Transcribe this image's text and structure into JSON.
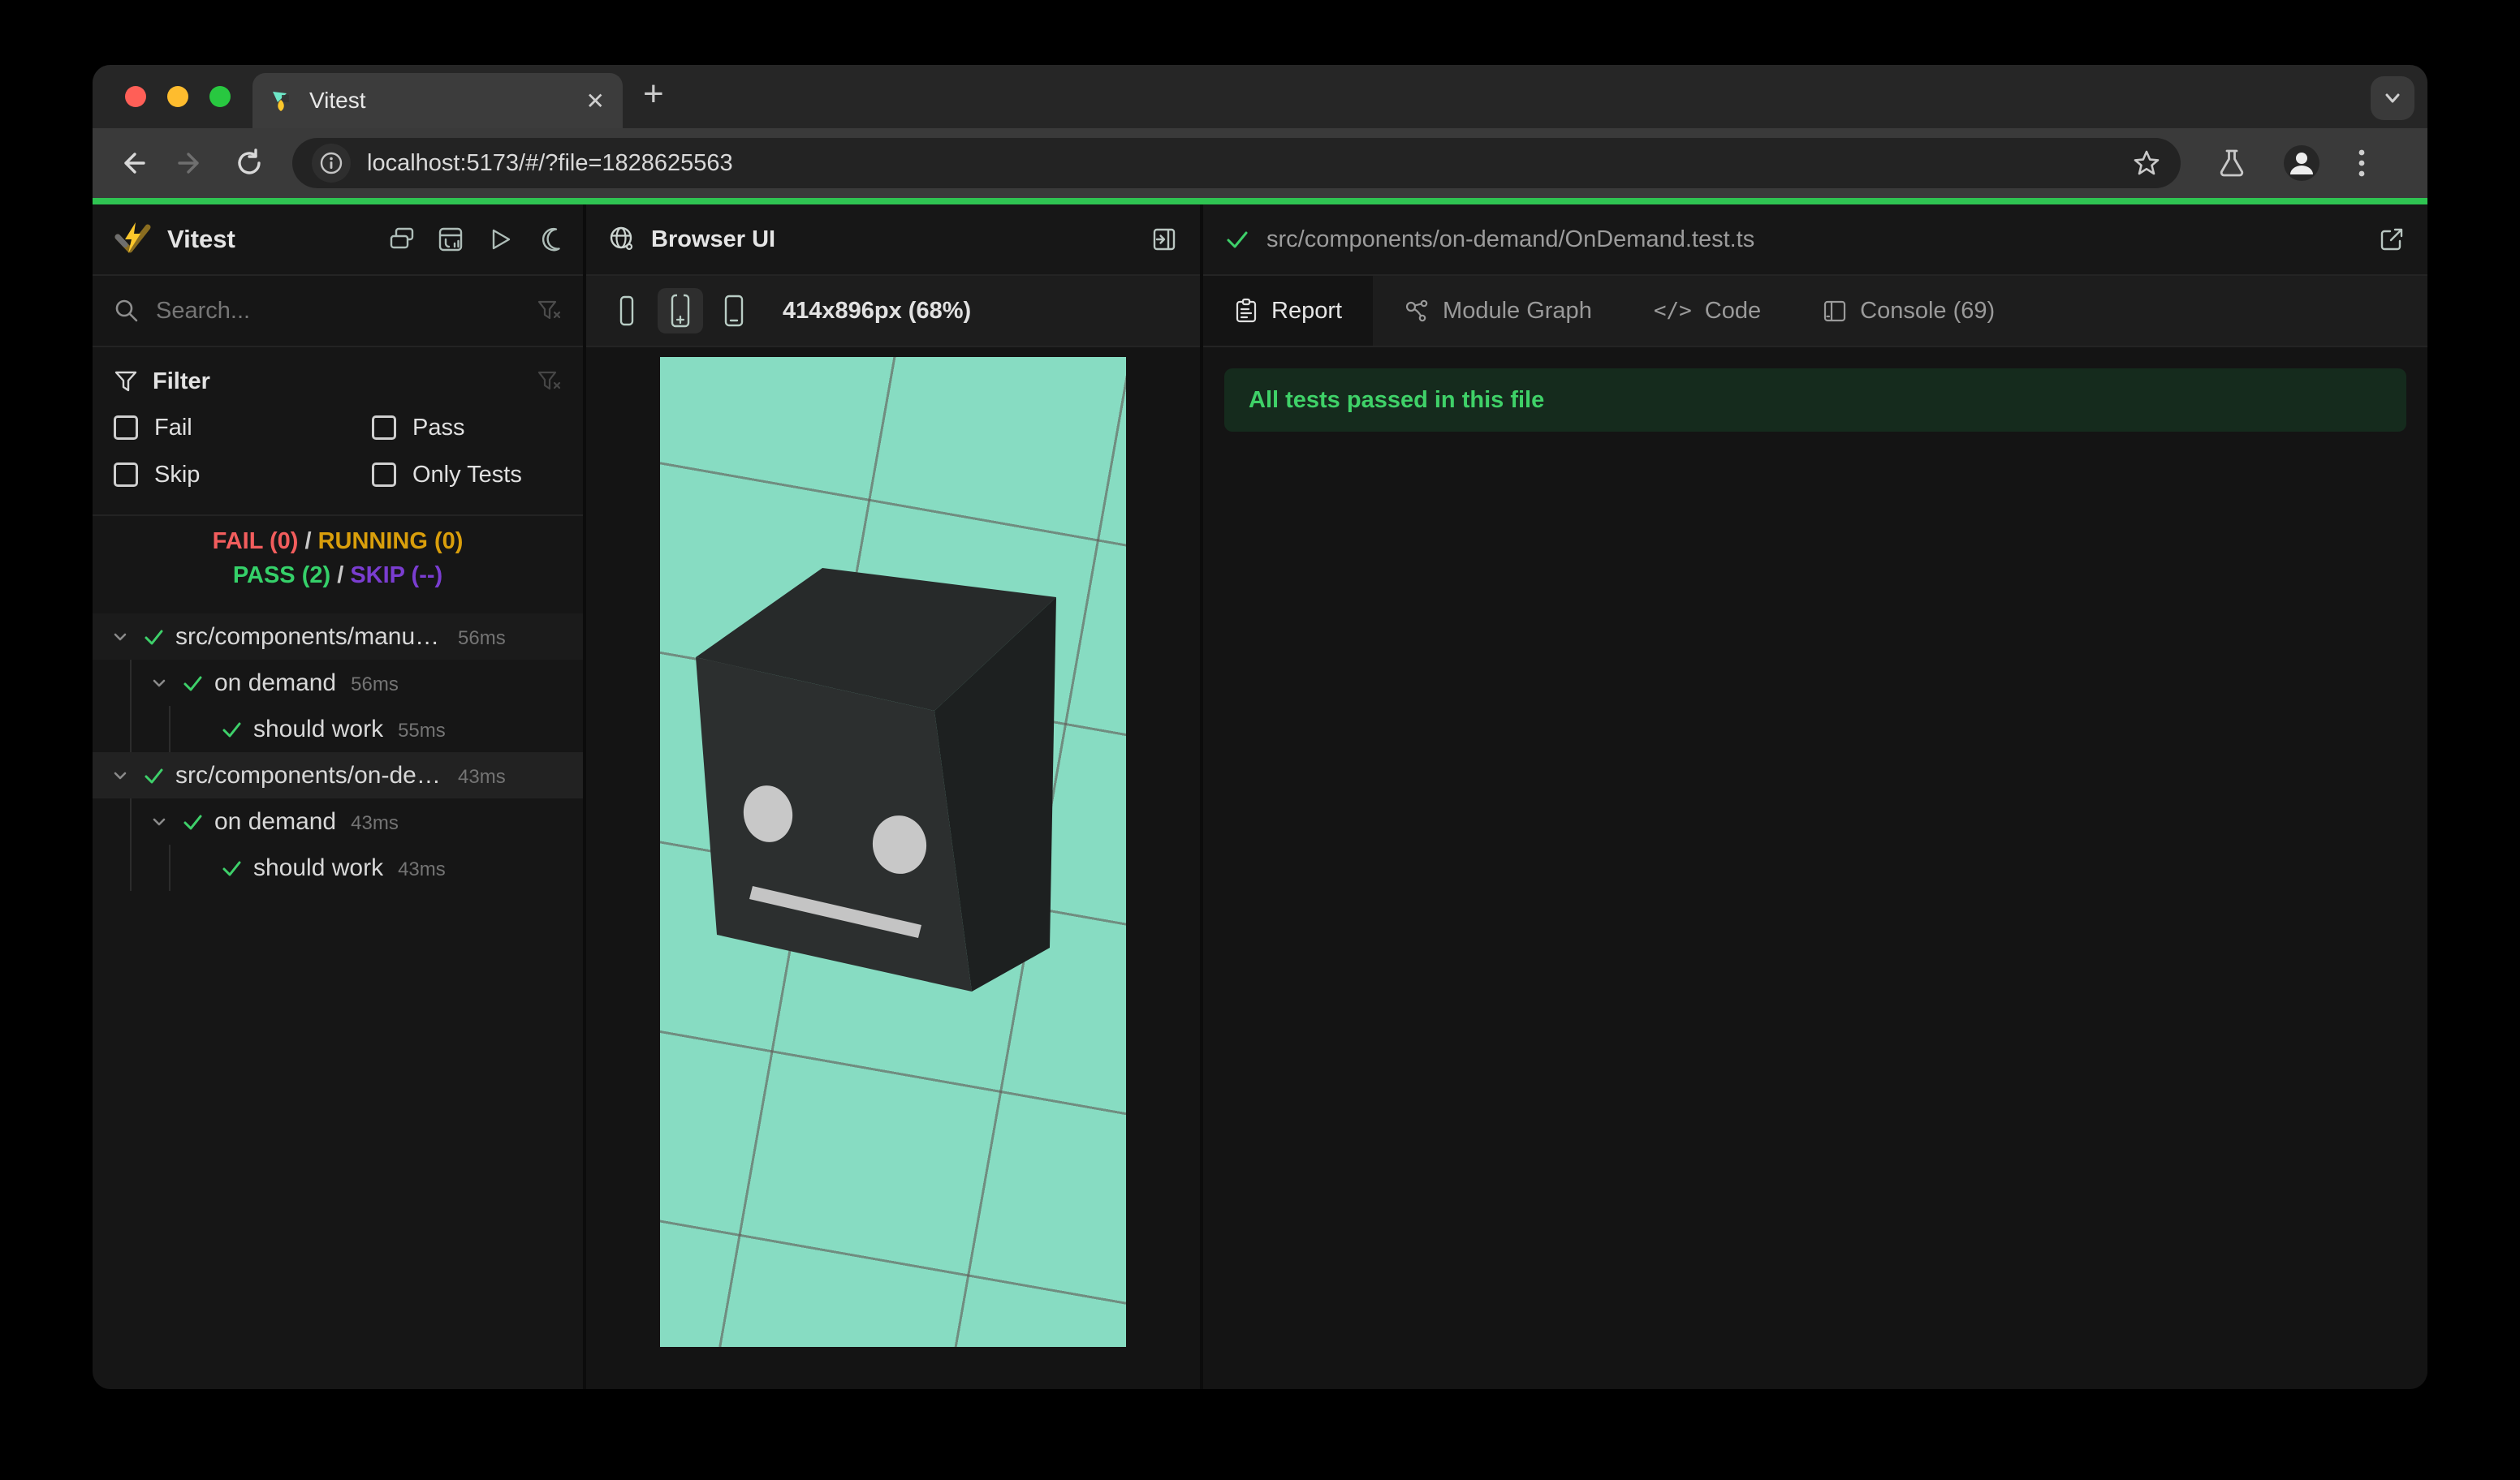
{
  "chrome": {
    "tab_title": "Vitest",
    "url": "localhost:5173/#/?file=1828625563",
    "close_glyph": "✕",
    "newtab_glyph": "+"
  },
  "sidebar": {
    "title": "Vitest",
    "search_placeholder": "Search...",
    "filter": {
      "label": "Filter",
      "items": [
        {
          "label": "Fail"
        },
        {
          "label": "Pass"
        },
        {
          "label": "Skip"
        },
        {
          "label": "Only Tests"
        }
      ]
    },
    "status": {
      "fail": "FAIL (0)",
      "running": "RUNNING (0)",
      "pass": "PASS (2)",
      "skip": "SKIP (--)",
      "sep": " / "
    },
    "tree": [
      {
        "type": "file",
        "label": "src/components/manual/…",
        "time": "56ms",
        "selected": false
      },
      {
        "type": "suite",
        "label": "on demand",
        "time": "56ms"
      },
      {
        "type": "test",
        "label": "should work",
        "time": "55ms"
      },
      {
        "type": "file",
        "label": "src/components/on-dema…",
        "time": "43ms",
        "selected": true
      },
      {
        "type": "suite",
        "label": "on demand",
        "time": "43ms"
      },
      {
        "type": "test",
        "label": "should work",
        "time": "43ms"
      }
    ]
  },
  "browser_panel": {
    "title": "Browser UI",
    "dimensions": "414x896px (68%)"
  },
  "report_panel": {
    "file_path": "src/components/on-demand/OnDemand.test.ts",
    "tabs": [
      {
        "label": "Report",
        "active": true
      },
      {
        "label": "Module Graph",
        "active": false
      },
      {
        "label": "Code",
        "active": false
      },
      {
        "label": "Console (69)",
        "active": false
      }
    ],
    "banner_text": "All tests passed in this file"
  },
  "colors": {
    "progress_green": "#2fc452",
    "fail_red": "#f25d5d",
    "running_amber": "#d99e0b",
    "pass_green": "#35d069",
    "skip_purple": "#7a3dd0",
    "check_green": "#3ed06a",
    "banner_bg": "#152b1d",
    "banner_text": "#3fd168",
    "scene_teal": "#87dcc2",
    "traffic_red": "#ff5f57",
    "traffic_yellow": "#febc2e",
    "traffic_green": "#28c840"
  }
}
